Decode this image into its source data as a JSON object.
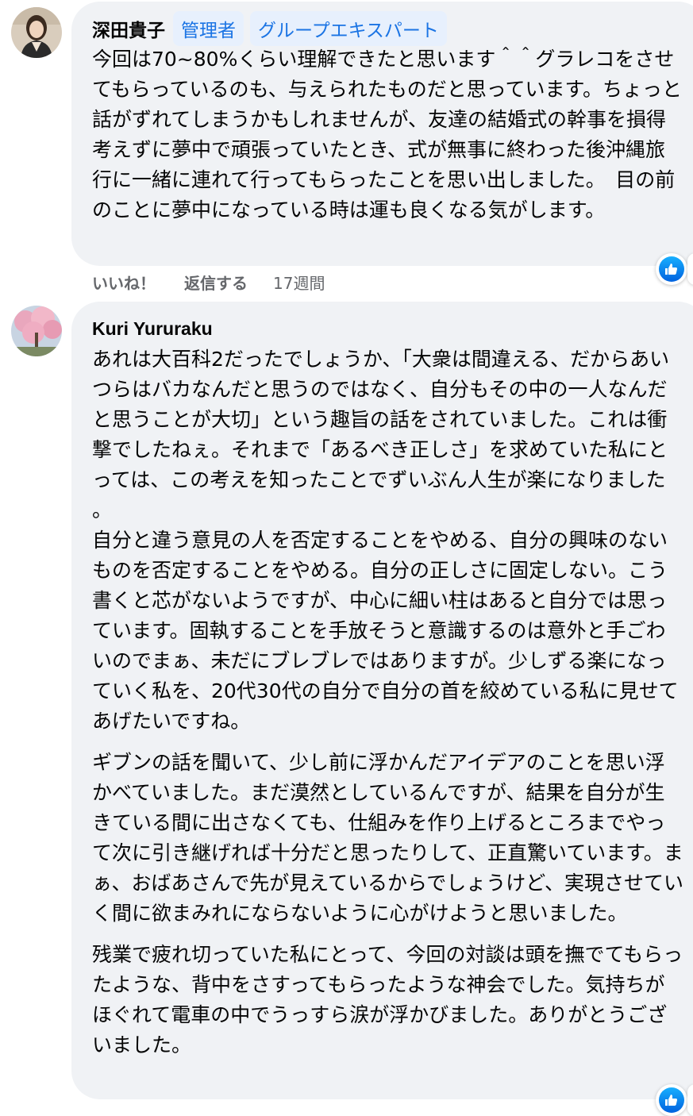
{
  "comments": [
    {
      "author": "深田貴子",
      "badges": [
        "管理者",
        "グループエキスパート"
      ],
      "paragraphs": [
        "今回は70~80%くらい理解できたと思います＾＾グラレコをさせてもらっているのも、与えられたものだと思っています。ちょっと話がずれてしまうかもしれませんが、友達の結婚式の幹事を損得考えずに夢中で頑張っていたとき、式が無事に終わった後沖縄旅行に一緒に連れて行ってもらったことを思い出しました。　目の前のことに夢中になっている時は運も良くなる気がします。"
      ],
      "actions": {
        "like": "いいね！",
        "reply": "返信する",
        "time": "17週間"
      },
      "reaction_icon": "thumbs-up-icon"
    },
    {
      "author": "Kuri Yururaku",
      "badges": [],
      "paragraphs": [
        "あれは大百科2だったでしょうか、「大衆は間違える、だからあいつらはバカなんだと思うのではなく、自分もその中の一人なんだと思うことが大切」という趣旨の話をされていました。これは衝撃でしたねぇ。それまで「あるべき正しさ」を求めていた私にとっては、この考えを知ったことでずいぶん人生が楽になりました。",
        "自分と違う意見の人を否定することをやめる、自分の興味のないものを否定することをやめる。自分の正しさに固定しない。こう書くと芯がないようですが、中心に細い柱はあると自分では思っています。固執することを手放そうと意識するのは意外と手ごわいのでまぁ、未だにブレブレではありますが。少しずる楽になっていく私を、20代30代の自分で自分の首を絞めている私に見せてあげたいですね。",
        "ギブンの話を聞いて、少し前に浮かんだアイデアのことを思い浮かべていました。まだ漠然としているんですが、結果を自分が生きている間に出さなくても、仕組みを作り上げるところまでやって次に引き継げれば十分だと思ったりして、正直驚いています。まぁ、おばあさんで先が見えているからでしょうけど、実現させていく間に欲まみれにならないように心がけようと思いました。",
        "残業で疲れ切っていた私にとって、今回の対談は頭を撫でてもらったような、背中をさすってもらったような神会でした。気持ちがほぐれて電車の中でうっすら涙が浮かびました。ありがとうございました。"
      ],
      "reaction_icon": "thumbs-up-icon"
    }
  ],
  "colors": {
    "bubble": "#f0f2f5",
    "badge_bg": "#e7f0fd",
    "badge_text": "#1b74e4",
    "meta_text": "#65676b",
    "like_blue": "#0866ff"
  }
}
